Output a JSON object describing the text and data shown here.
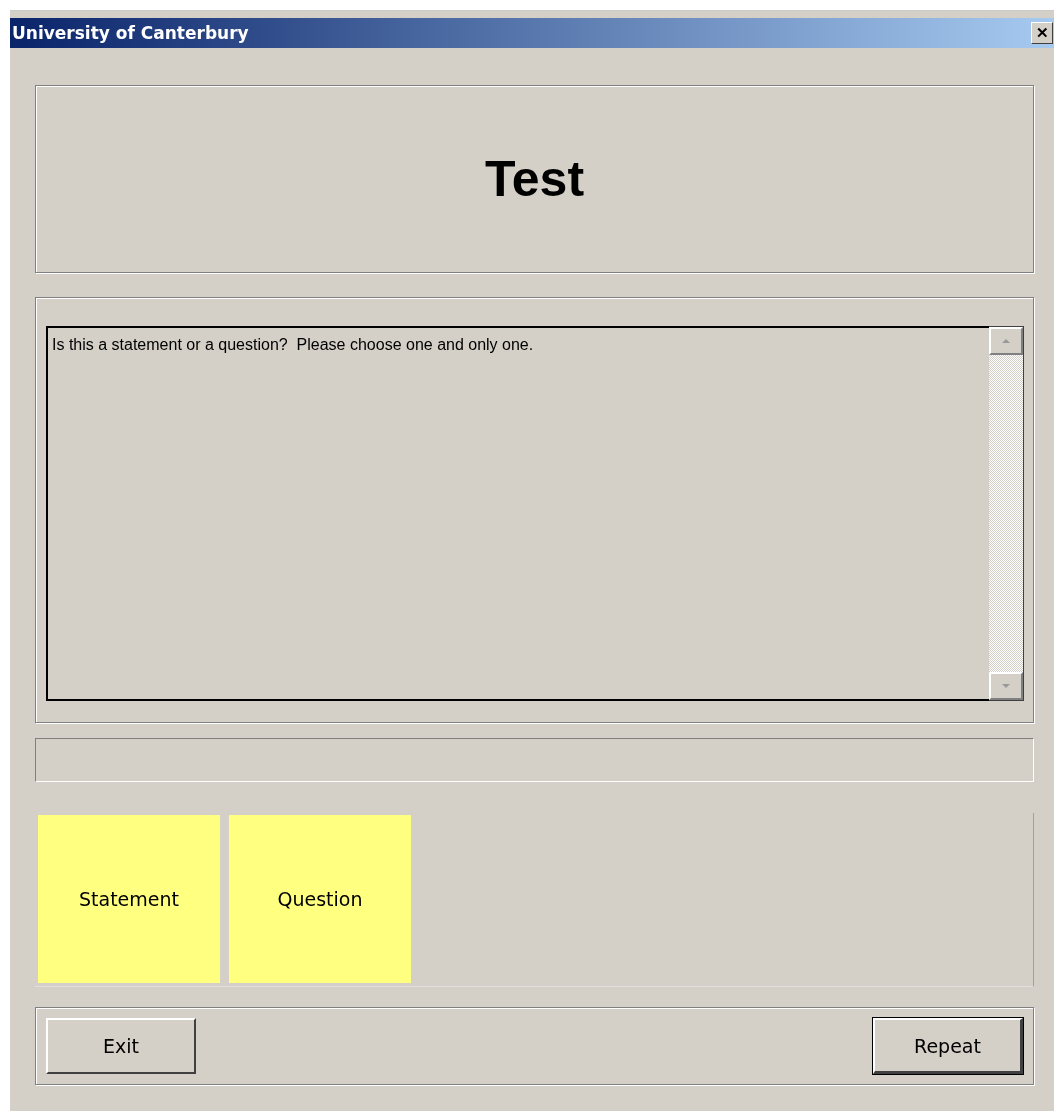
{
  "window": {
    "title": "University of Canterbury",
    "close": "✕"
  },
  "heading": "Test",
  "prompt": "Is this a statement or a question?  Please choose one and only one.",
  "answers": [
    {
      "label": "Statement",
      "color": "#ffff80"
    },
    {
      "label": "Question",
      "color": "#ffff80"
    }
  ],
  "buttons": [
    {
      "label": "Exit",
      "default": false
    },
    {
      "label": "Repeat",
      "default": true
    }
  ]
}
